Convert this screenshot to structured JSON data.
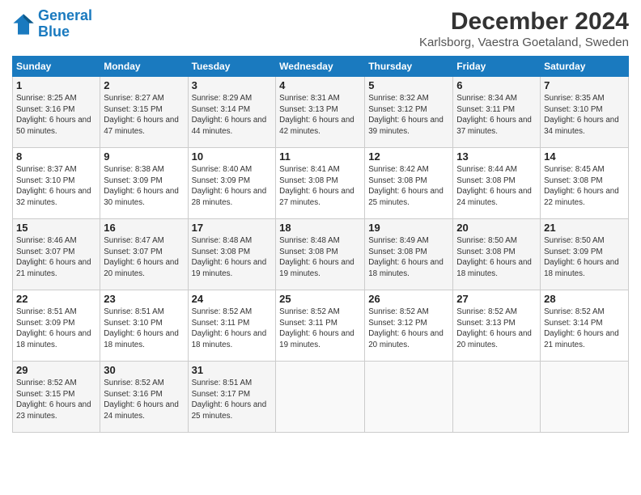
{
  "header": {
    "logo_line1": "General",
    "logo_line2": "Blue",
    "title": "December 2024",
    "subtitle": "Karlsborg, Vaestra Goetaland, Sweden"
  },
  "days_of_week": [
    "Sunday",
    "Monday",
    "Tuesday",
    "Wednesday",
    "Thursday",
    "Friday",
    "Saturday"
  ],
  "weeks": [
    [
      {
        "day": "1",
        "sunrise": "Sunrise: 8:25 AM",
        "sunset": "Sunset: 3:16 PM",
        "daylight": "Daylight: 6 hours and 50 minutes."
      },
      {
        "day": "2",
        "sunrise": "Sunrise: 8:27 AM",
        "sunset": "Sunset: 3:15 PM",
        "daylight": "Daylight: 6 hours and 47 minutes."
      },
      {
        "day": "3",
        "sunrise": "Sunrise: 8:29 AM",
        "sunset": "Sunset: 3:14 PM",
        "daylight": "Daylight: 6 hours and 44 minutes."
      },
      {
        "day": "4",
        "sunrise": "Sunrise: 8:31 AM",
        "sunset": "Sunset: 3:13 PM",
        "daylight": "Daylight: 6 hours and 42 minutes."
      },
      {
        "day": "5",
        "sunrise": "Sunrise: 8:32 AM",
        "sunset": "Sunset: 3:12 PM",
        "daylight": "Daylight: 6 hours and 39 minutes."
      },
      {
        "day": "6",
        "sunrise": "Sunrise: 8:34 AM",
        "sunset": "Sunset: 3:11 PM",
        "daylight": "Daylight: 6 hours and 37 minutes."
      },
      {
        "day": "7",
        "sunrise": "Sunrise: 8:35 AM",
        "sunset": "Sunset: 3:10 PM",
        "daylight": "Daylight: 6 hours and 34 minutes."
      }
    ],
    [
      {
        "day": "8",
        "sunrise": "Sunrise: 8:37 AM",
        "sunset": "Sunset: 3:10 PM",
        "daylight": "Daylight: 6 hours and 32 minutes."
      },
      {
        "day": "9",
        "sunrise": "Sunrise: 8:38 AM",
        "sunset": "Sunset: 3:09 PM",
        "daylight": "Daylight: 6 hours and 30 minutes."
      },
      {
        "day": "10",
        "sunrise": "Sunrise: 8:40 AM",
        "sunset": "Sunset: 3:09 PM",
        "daylight": "Daylight: 6 hours and 28 minutes."
      },
      {
        "day": "11",
        "sunrise": "Sunrise: 8:41 AM",
        "sunset": "Sunset: 3:08 PM",
        "daylight": "Daylight: 6 hours and 27 minutes."
      },
      {
        "day": "12",
        "sunrise": "Sunrise: 8:42 AM",
        "sunset": "Sunset: 3:08 PM",
        "daylight": "Daylight: 6 hours and 25 minutes."
      },
      {
        "day": "13",
        "sunrise": "Sunrise: 8:44 AM",
        "sunset": "Sunset: 3:08 PM",
        "daylight": "Daylight: 6 hours and 24 minutes."
      },
      {
        "day": "14",
        "sunrise": "Sunrise: 8:45 AM",
        "sunset": "Sunset: 3:08 PM",
        "daylight": "Daylight: 6 hours and 22 minutes."
      }
    ],
    [
      {
        "day": "15",
        "sunrise": "Sunrise: 8:46 AM",
        "sunset": "Sunset: 3:07 PM",
        "daylight": "Daylight: 6 hours and 21 minutes."
      },
      {
        "day": "16",
        "sunrise": "Sunrise: 8:47 AM",
        "sunset": "Sunset: 3:07 PM",
        "daylight": "Daylight: 6 hours and 20 minutes."
      },
      {
        "day": "17",
        "sunrise": "Sunrise: 8:48 AM",
        "sunset": "Sunset: 3:08 PM",
        "daylight": "Daylight: 6 hours and 19 minutes."
      },
      {
        "day": "18",
        "sunrise": "Sunrise: 8:48 AM",
        "sunset": "Sunset: 3:08 PM",
        "daylight": "Daylight: 6 hours and 19 minutes."
      },
      {
        "day": "19",
        "sunrise": "Sunrise: 8:49 AM",
        "sunset": "Sunset: 3:08 PM",
        "daylight": "Daylight: 6 hours and 18 minutes."
      },
      {
        "day": "20",
        "sunrise": "Sunrise: 8:50 AM",
        "sunset": "Sunset: 3:08 PM",
        "daylight": "Daylight: 6 hours and 18 minutes."
      },
      {
        "day": "21",
        "sunrise": "Sunrise: 8:50 AM",
        "sunset": "Sunset: 3:09 PM",
        "daylight": "Daylight: 6 hours and 18 minutes."
      }
    ],
    [
      {
        "day": "22",
        "sunrise": "Sunrise: 8:51 AM",
        "sunset": "Sunset: 3:09 PM",
        "daylight": "Daylight: 6 hours and 18 minutes."
      },
      {
        "day": "23",
        "sunrise": "Sunrise: 8:51 AM",
        "sunset": "Sunset: 3:10 PM",
        "daylight": "Daylight: 6 hours and 18 minutes."
      },
      {
        "day": "24",
        "sunrise": "Sunrise: 8:52 AM",
        "sunset": "Sunset: 3:11 PM",
        "daylight": "Daylight: 6 hours and 18 minutes."
      },
      {
        "day": "25",
        "sunrise": "Sunrise: 8:52 AM",
        "sunset": "Sunset: 3:11 PM",
        "daylight": "Daylight: 6 hours and 19 minutes."
      },
      {
        "day": "26",
        "sunrise": "Sunrise: 8:52 AM",
        "sunset": "Sunset: 3:12 PM",
        "daylight": "Daylight: 6 hours and 20 minutes."
      },
      {
        "day": "27",
        "sunrise": "Sunrise: 8:52 AM",
        "sunset": "Sunset: 3:13 PM",
        "daylight": "Daylight: 6 hours and 20 minutes."
      },
      {
        "day": "28",
        "sunrise": "Sunrise: 8:52 AM",
        "sunset": "Sunset: 3:14 PM",
        "daylight": "Daylight: 6 hours and 21 minutes."
      }
    ],
    [
      {
        "day": "29",
        "sunrise": "Sunrise: 8:52 AM",
        "sunset": "Sunset: 3:15 PM",
        "daylight": "Daylight: 6 hours and 23 minutes."
      },
      {
        "day": "30",
        "sunrise": "Sunrise: 8:52 AM",
        "sunset": "Sunset: 3:16 PM",
        "daylight": "Daylight: 6 hours and 24 minutes."
      },
      {
        "day": "31",
        "sunrise": "Sunrise: 8:51 AM",
        "sunset": "Sunset: 3:17 PM",
        "daylight": "Daylight: 6 hours and 25 minutes."
      },
      null,
      null,
      null,
      null
    ]
  ],
  "accent_color": "#1a7abf"
}
